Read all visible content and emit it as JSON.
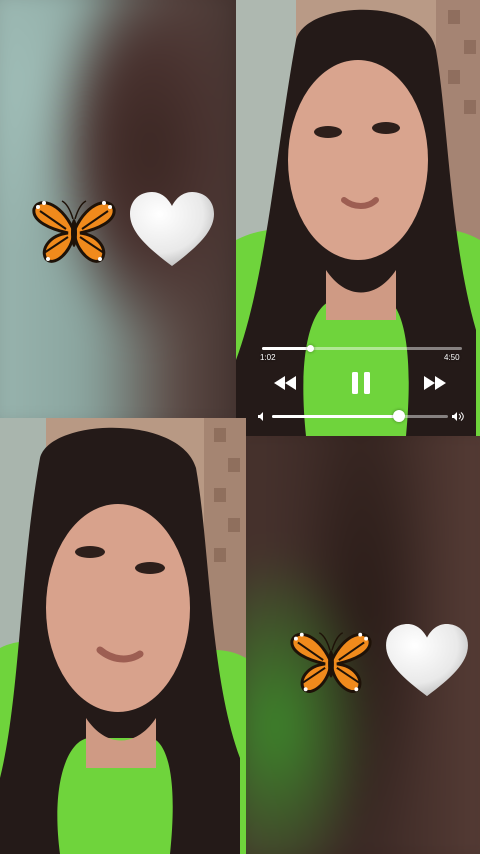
{
  "player": {
    "elapsed": "1:02",
    "duration": "4:50",
    "progress": 0.24,
    "volume": 0.72
  },
  "stickers": {
    "top_left": [
      "butterfly-icon",
      "white-heart-icon"
    ],
    "bottom_right": [
      "butterfly-icon",
      "white-heart-icon"
    ]
  }
}
